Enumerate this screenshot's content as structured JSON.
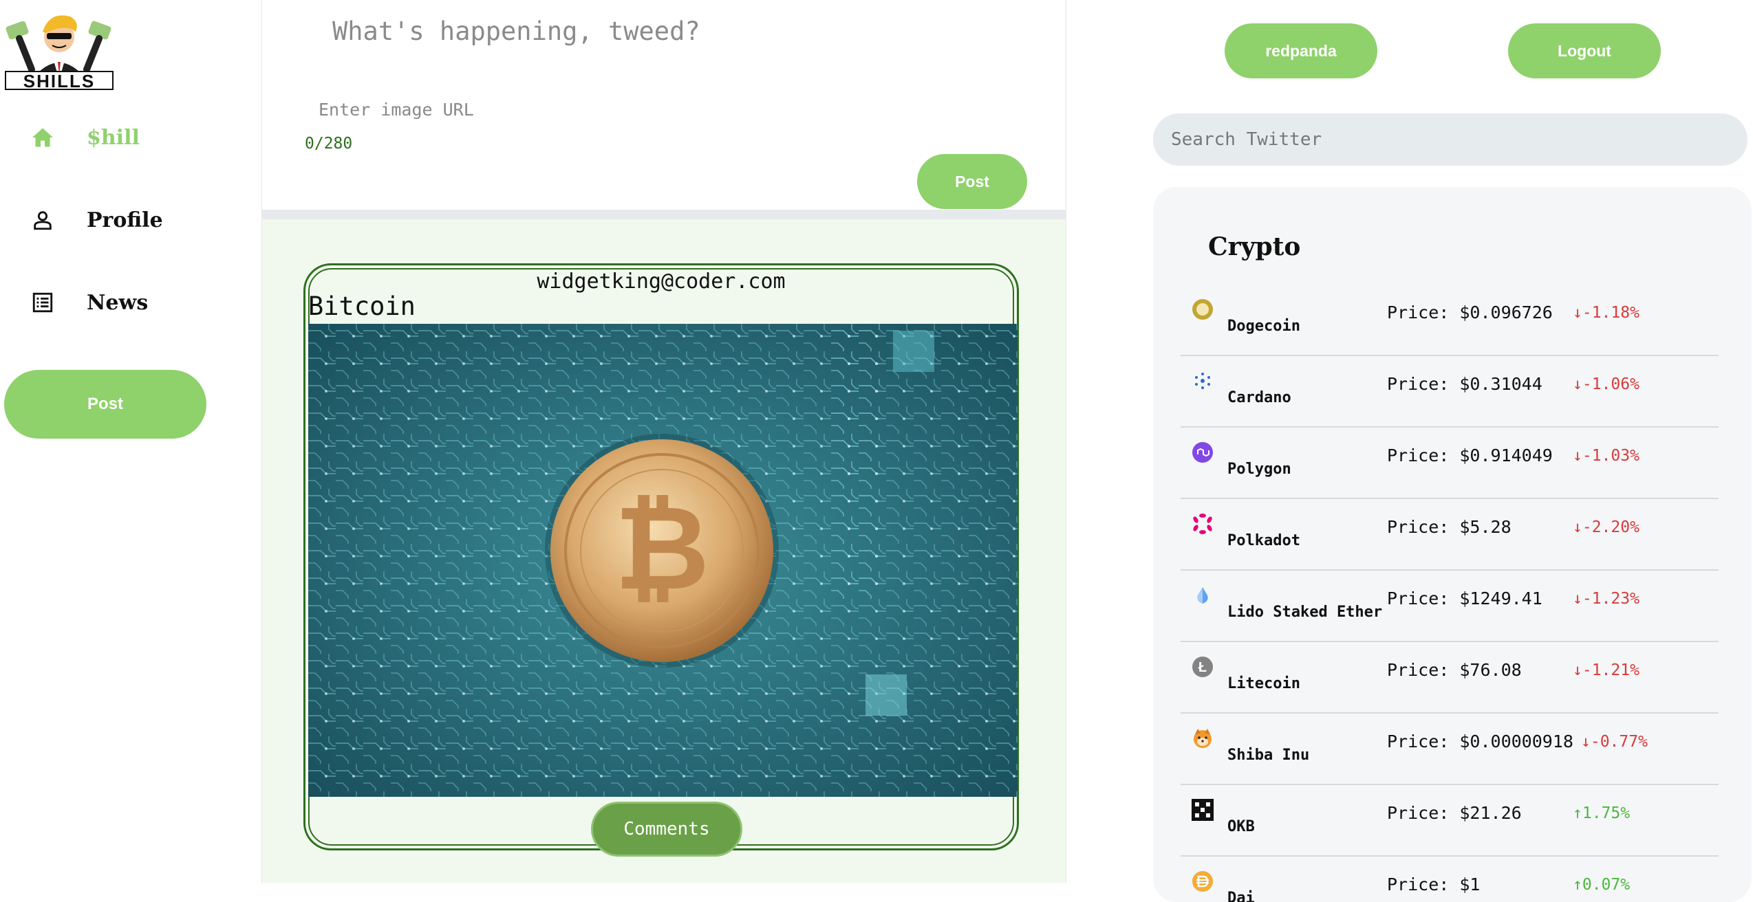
{
  "sidebar": {
    "logo_text": "SHILLS",
    "nav": [
      {
        "label": "$hill",
        "icon": "home-icon",
        "active": true
      },
      {
        "label": "Profile",
        "icon": "person-icon",
        "active": false
      },
      {
        "label": "News",
        "icon": "news-icon",
        "active": false
      }
    ],
    "post_label": "Post"
  },
  "composer": {
    "placeholder": "What's happening, tweed?",
    "image_url_placeholder": "Enter image URL",
    "char_count": "0/280",
    "post_label": "Post"
  },
  "feed": {
    "tweets": [
      {
        "author": "widgetking@coder.com",
        "title": "Bitcoin",
        "image_alt": "Bitcoin coin on a circuit board",
        "comments_label": "Comments"
      }
    ]
  },
  "header": {
    "username": "redpanda",
    "logout_label": "Logout",
    "search_placeholder": "Search Twitter"
  },
  "crypto": {
    "heading": "Crypto",
    "coins": [
      {
        "name": "Dogecoin",
        "price": "Price: $0.096726",
        "change": "↓-1.18%",
        "direction": "down",
        "icon": "dogecoin-icon"
      },
      {
        "name": "Cardano",
        "price": "Price: $0.31044",
        "change": "↓-1.06%",
        "direction": "down",
        "icon": "cardano-icon"
      },
      {
        "name": "Polygon",
        "price": "Price: $0.914049",
        "change": "↓-1.03%",
        "direction": "down",
        "icon": "polygon-icon"
      },
      {
        "name": "Polkadot",
        "price": "Price: $5.28",
        "change": "↓-2.20%",
        "direction": "down",
        "icon": "polkadot-icon"
      },
      {
        "name": "Lido Staked Ether",
        "price": "Price: $1249.41",
        "change": "↓-1.23%",
        "direction": "down",
        "icon": "lido-icon"
      },
      {
        "name": "Litecoin",
        "price": "Price: $76.08",
        "change": "↓-1.21%",
        "direction": "down",
        "icon": "litecoin-icon"
      },
      {
        "name": "Shiba Inu",
        "price": "Price: $0.00000918",
        "change": "↓-0.77%",
        "direction": "down",
        "icon": "shiba-inu-icon"
      },
      {
        "name": "OKB",
        "price": "Price: $21.26",
        "change": "↑1.75%",
        "direction": "up",
        "icon": "okb-icon"
      },
      {
        "name": "Dai",
        "price": "Price: $1",
        "change": "↑0.07%",
        "direction": "up",
        "icon": "dai-icon"
      }
    ]
  },
  "colors": {
    "accent": "#8fd16b",
    "dark_green": "#2f6f1f",
    "feed_bg": "#f1f9ee",
    "down": "#d93a3a",
    "up": "#4cb83c"
  }
}
